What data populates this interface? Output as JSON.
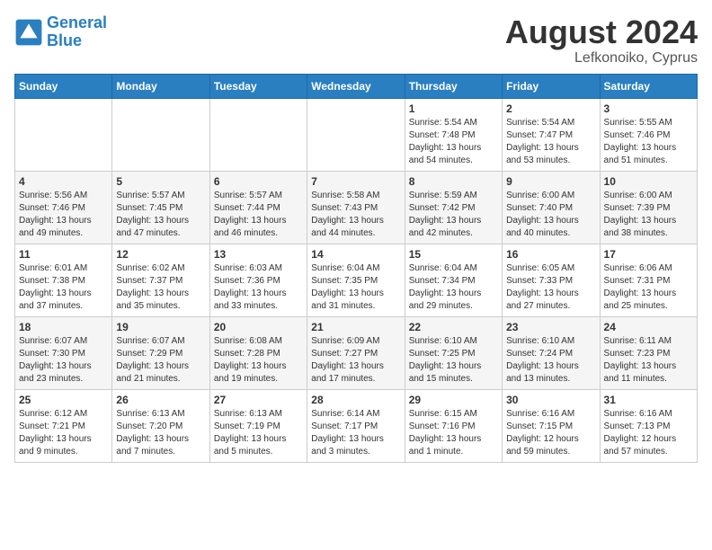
{
  "header": {
    "logo_line1": "General",
    "logo_line2": "Blue",
    "month_year": "August 2024",
    "location": "Lefkonoiko, Cyprus"
  },
  "weekdays": [
    "Sunday",
    "Monday",
    "Tuesday",
    "Wednesday",
    "Thursday",
    "Friday",
    "Saturday"
  ],
  "weeks": [
    [
      {
        "day": "",
        "info": ""
      },
      {
        "day": "",
        "info": ""
      },
      {
        "day": "",
        "info": ""
      },
      {
        "day": "",
        "info": ""
      },
      {
        "day": "1",
        "info": "Sunrise: 5:54 AM\nSunset: 7:48 PM\nDaylight: 13 hours\nand 54 minutes."
      },
      {
        "day": "2",
        "info": "Sunrise: 5:54 AM\nSunset: 7:47 PM\nDaylight: 13 hours\nand 53 minutes."
      },
      {
        "day": "3",
        "info": "Sunrise: 5:55 AM\nSunset: 7:46 PM\nDaylight: 13 hours\nand 51 minutes."
      }
    ],
    [
      {
        "day": "4",
        "info": "Sunrise: 5:56 AM\nSunset: 7:46 PM\nDaylight: 13 hours\nand 49 minutes."
      },
      {
        "day": "5",
        "info": "Sunrise: 5:57 AM\nSunset: 7:45 PM\nDaylight: 13 hours\nand 47 minutes."
      },
      {
        "day": "6",
        "info": "Sunrise: 5:57 AM\nSunset: 7:44 PM\nDaylight: 13 hours\nand 46 minutes."
      },
      {
        "day": "7",
        "info": "Sunrise: 5:58 AM\nSunset: 7:43 PM\nDaylight: 13 hours\nand 44 minutes."
      },
      {
        "day": "8",
        "info": "Sunrise: 5:59 AM\nSunset: 7:42 PM\nDaylight: 13 hours\nand 42 minutes."
      },
      {
        "day": "9",
        "info": "Sunrise: 6:00 AM\nSunset: 7:40 PM\nDaylight: 13 hours\nand 40 minutes."
      },
      {
        "day": "10",
        "info": "Sunrise: 6:00 AM\nSunset: 7:39 PM\nDaylight: 13 hours\nand 38 minutes."
      }
    ],
    [
      {
        "day": "11",
        "info": "Sunrise: 6:01 AM\nSunset: 7:38 PM\nDaylight: 13 hours\nand 37 minutes."
      },
      {
        "day": "12",
        "info": "Sunrise: 6:02 AM\nSunset: 7:37 PM\nDaylight: 13 hours\nand 35 minutes."
      },
      {
        "day": "13",
        "info": "Sunrise: 6:03 AM\nSunset: 7:36 PM\nDaylight: 13 hours\nand 33 minutes."
      },
      {
        "day": "14",
        "info": "Sunrise: 6:04 AM\nSunset: 7:35 PM\nDaylight: 13 hours\nand 31 minutes."
      },
      {
        "day": "15",
        "info": "Sunrise: 6:04 AM\nSunset: 7:34 PM\nDaylight: 13 hours\nand 29 minutes."
      },
      {
        "day": "16",
        "info": "Sunrise: 6:05 AM\nSunset: 7:33 PM\nDaylight: 13 hours\nand 27 minutes."
      },
      {
        "day": "17",
        "info": "Sunrise: 6:06 AM\nSunset: 7:31 PM\nDaylight: 13 hours\nand 25 minutes."
      }
    ],
    [
      {
        "day": "18",
        "info": "Sunrise: 6:07 AM\nSunset: 7:30 PM\nDaylight: 13 hours\nand 23 minutes."
      },
      {
        "day": "19",
        "info": "Sunrise: 6:07 AM\nSunset: 7:29 PM\nDaylight: 13 hours\nand 21 minutes."
      },
      {
        "day": "20",
        "info": "Sunrise: 6:08 AM\nSunset: 7:28 PM\nDaylight: 13 hours\nand 19 minutes."
      },
      {
        "day": "21",
        "info": "Sunrise: 6:09 AM\nSunset: 7:27 PM\nDaylight: 13 hours\nand 17 minutes."
      },
      {
        "day": "22",
        "info": "Sunrise: 6:10 AM\nSunset: 7:25 PM\nDaylight: 13 hours\nand 15 minutes."
      },
      {
        "day": "23",
        "info": "Sunrise: 6:10 AM\nSunset: 7:24 PM\nDaylight: 13 hours\nand 13 minutes."
      },
      {
        "day": "24",
        "info": "Sunrise: 6:11 AM\nSunset: 7:23 PM\nDaylight: 13 hours\nand 11 minutes."
      }
    ],
    [
      {
        "day": "25",
        "info": "Sunrise: 6:12 AM\nSunset: 7:21 PM\nDaylight: 13 hours\nand 9 minutes."
      },
      {
        "day": "26",
        "info": "Sunrise: 6:13 AM\nSunset: 7:20 PM\nDaylight: 13 hours\nand 7 minutes."
      },
      {
        "day": "27",
        "info": "Sunrise: 6:13 AM\nSunset: 7:19 PM\nDaylight: 13 hours\nand 5 minutes."
      },
      {
        "day": "28",
        "info": "Sunrise: 6:14 AM\nSunset: 7:17 PM\nDaylight: 13 hours\nand 3 minutes."
      },
      {
        "day": "29",
        "info": "Sunrise: 6:15 AM\nSunset: 7:16 PM\nDaylight: 13 hours\nand 1 minute."
      },
      {
        "day": "30",
        "info": "Sunrise: 6:16 AM\nSunset: 7:15 PM\nDaylight: 12 hours\nand 59 minutes."
      },
      {
        "day": "31",
        "info": "Sunrise: 6:16 AM\nSunset: 7:13 PM\nDaylight: 12 hours\nand 57 minutes."
      }
    ]
  ]
}
